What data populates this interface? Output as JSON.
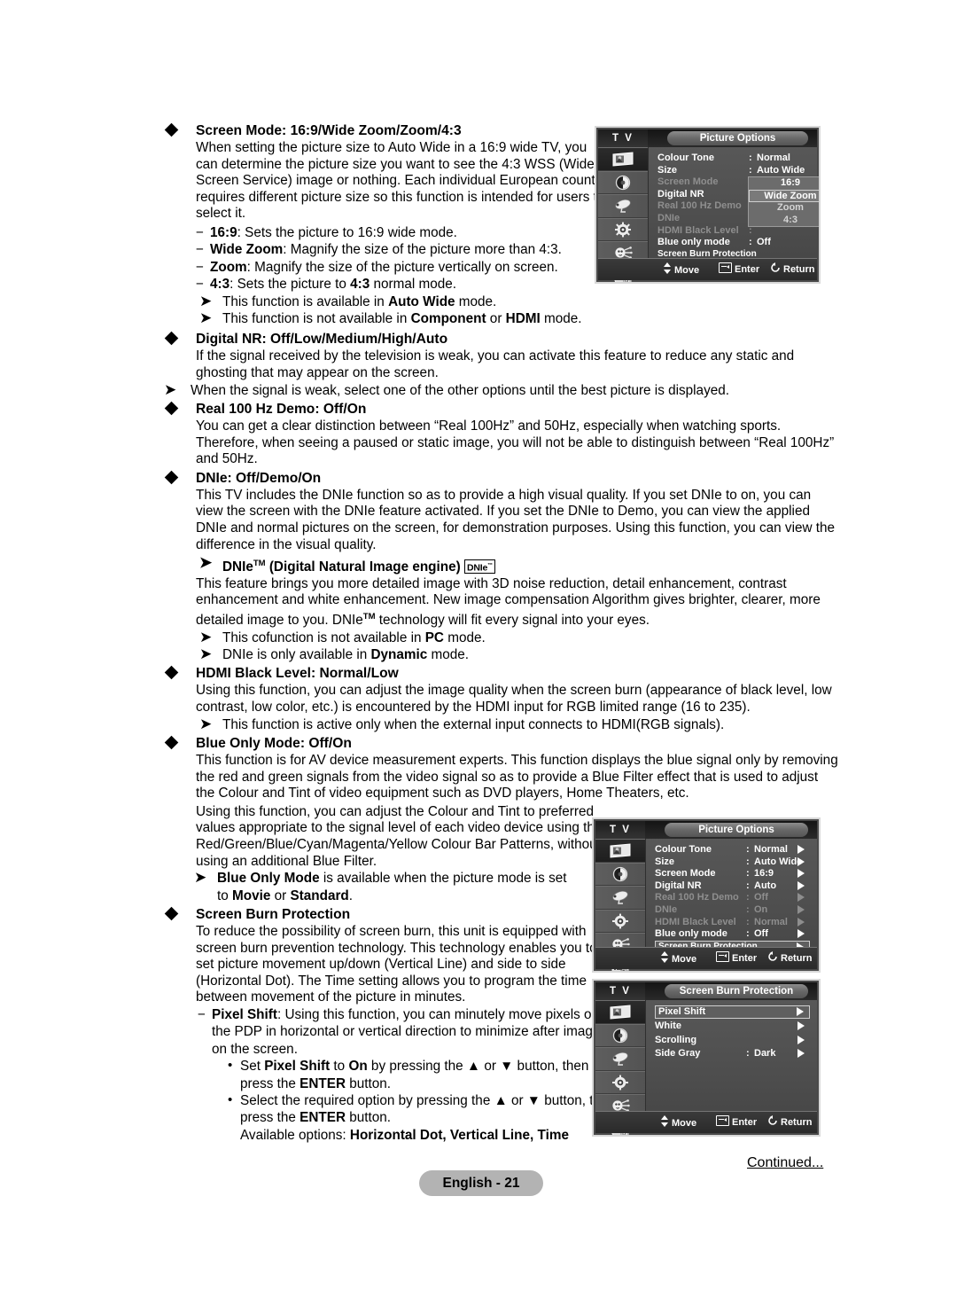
{
  "page": {
    "footer_badge": "English - 21",
    "continued": "Continued..."
  },
  "sections": [
    {
      "id": "screen-mode",
      "heading": "Screen Mode: 16:9/Wide Zoom/Zoom/4:3",
      "paragraph": "When setting the picture size to Auto Wide in a 16:9 wide TV, you can determine the picture size you want to see the 4:3 WSS (Wide Screen Service) image or nothing. Each individual European country requires different picture size so this function is intended for users to select it.",
      "dashes": [
        {
          "term": "16:9",
          "rest": ": Sets the picture to 16:9 wide mode."
        },
        {
          "term": "Wide Zoom",
          "rest": ": Magnify the size of the picture more than 4:3."
        },
        {
          "term": "Zoom",
          "rest": ": Magnify the size of the picture vertically on screen."
        },
        {
          "term": "4:3",
          "rest": ": Sets the picture to 4:3 normal mode."
        }
      ],
      "notes": [
        "This function is available in Auto Wide mode.",
        "This function is not available in Component or HDMI mode."
      ]
    },
    {
      "id": "digital-nr",
      "heading": "Digital NR: Off/Low/Medium/High/Auto",
      "paragraph": "If the signal received by the television is weak, you can activate this feature to reduce any static and ghosting that may appear on the screen.",
      "notes": [
        "When the signal is weak, select one of the other options until the best picture is displayed."
      ]
    },
    {
      "id": "real-100hz-demo",
      "heading": "Real 100 Hz Demo: Off/On",
      "paragraph": "You can get a clear distinction between “Real 100Hz” and 50Hz, especially when watching sports. Therefore, when seeing a paused or static image, you will not be able to distinguish between “Real 100Hz” and 50Hz."
    },
    {
      "id": "dnie",
      "heading": "DNIe: Off/Demo/On",
      "paragraph": "This TV includes the DNIe function so as to provide a high visual quality. If you set DNIe to on, you can view the screen with the DNIe feature activated. If you set the DNIe to Demo, you can view the applied DNIe and normal pictures on the screen, for demonstration purposes. Using this function, you can view the difference in the visual quality.",
      "sub_note_heading": "DNIe",
      "sub_note_heading_rest": "(Digital Natural Image engine)",
      "sub_note_badge": "DNIe",
      "sub_paragraph": "This feature brings you more detailed image with 3D noise reduction, detail enhancement, contrast enhancement and white enhancement. New image compensation Algorithm gives brighter, clearer, more detailed image to you. DNIe",
      "sub_paragraph_tail": " technology will fit every signal into your eyes.",
      "notes": [
        "This cofunction is not available in PC mode.",
        "DNIe is only available in Dynamic mode."
      ]
    },
    {
      "id": "hdmi-black-level",
      "heading": "HDMI Black Level: Normal/Low",
      "paragraph": "Using this function, you can adjust the image quality when the screen burn (appearance of black level, low contrast, low color, etc.) is encountered by the HDMI input for RGB limited range (16 to 235).",
      "notes": [
        "This function is active only when the external input connects to HDMI(RGB signals)."
      ]
    },
    {
      "id": "blue-only-mode",
      "heading": "Blue Only Mode: Off/On",
      "paragraph": "This function is for AV device measurement experts. This function displays the blue signal only by removing the red and green signals from the video signal so as to provide a Blue Filter effect that is used to adjust the Colour and Tint of video equipment such as DVD players, Home Theaters, etc.",
      "paragraph2": "Using this function, you can adjust the Colour and Tint to preferred values appropriate to the signal level of each video device using the Red/Green/Blue/Cyan/Magenta/Yellow Colour Bar Patterns, without using an additional Blue Filter.",
      "note_bold": "Blue Only Mode",
      "note_rest": " is available when the picture mode is set to ",
      "note_b2": "Movie",
      "note_mid": " or ",
      "note_b3": "Standard",
      "note_end": "."
    },
    {
      "id": "screen-burn-protection",
      "heading": "Screen Burn Protection",
      "paragraph": "To reduce the possibility of screen burn, this unit is equipped with screen burn prevention technology. This technology enables you to set picture movement up/down (Vertical Line) and side to side (Horizontal Dot). The Time setting allows you to program the time between movement of the picture in minutes.",
      "dash_term": "Pixel Shift",
      "dash_rest": ": Using this function, you can minutely move pixels on the PDP in horizontal or vertical direction to minimize after image on the screen.",
      "bullets": [
        {
          "pre": "Set ",
          "b1": "Pixel Shift",
          "mid": " to ",
          "b2": "On",
          "mid2": " by pressing the ▲ or ▼ button, then press the ",
          "b3": "ENTER",
          "tail": " button."
        },
        {
          "pre": "Select the required option by pressing the ▲ or ▼ button, then press the ",
          "b1": "ENTER",
          "tail": " button."
        }
      ],
      "available_label": "Available options: ",
      "available_options": "Horizontal Dot, Vertical Line, Time"
    }
  ],
  "osd1": {
    "tv_label": "T V",
    "title": "Picture Options",
    "rows": [
      {
        "label": "Colour Tone",
        "value": "Normal",
        "dim": false,
        "has_colon": true
      },
      {
        "label": "Size",
        "value": "Auto Wide",
        "dim": false,
        "has_colon": true
      },
      {
        "label": "Screen Mode",
        "value": "",
        "dim": true,
        "has_colon": true
      },
      {
        "label": "Digital NR",
        "value": "",
        "dim": false,
        "has_colon": true
      },
      {
        "label": "Real 100 Hz Demo",
        "value": "",
        "dim": true,
        "has_colon": true
      },
      {
        "label": "DNIe",
        "value": "",
        "dim": true,
        "has_colon": true
      },
      {
        "label": "HDMI Black Level",
        "value": "",
        "dim": true,
        "has_colon": true
      },
      {
        "label": "Blue only mode",
        "value": "Off",
        "dim": false,
        "has_colon": true
      },
      {
        "label": "Screen Burn Protection",
        "value": "",
        "dim": false,
        "has_colon": false
      }
    ],
    "dropdown": [
      {
        "label": "16:9",
        "state": "cur"
      },
      {
        "label": "Wide Zoom",
        "state": "hl"
      },
      {
        "label": "Zoom",
        "state": "normal"
      },
      {
        "label": "4:3",
        "state": "normal"
      }
    ],
    "footer": {
      "move": "Move",
      "enter": "Enter",
      "return": "Return"
    }
  },
  "osd2": {
    "tv_label": "T V",
    "title": "Picture Options",
    "rows": [
      {
        "label": "Colour Tone",
        "value": "Normal",
        "dim": false,
        "has_colon": true,
        "arrow": true,
        "selected": false
      },
      {
        "label": "Size",
        "value": "Auto Wide",
        "dim": false,
        "has_colon": true,
        "arrow": true,
        "selected": false
      },
      {
        "label": "Screen Mode",
        "value": "16:9",
        "dim": false,
        "has_colon": true,
        "arrow": true,
        "selected": false
      },
      {
        "label": "Digital NR",
        "value": "Auto",
        "dim": false,
        "has_colon": true,
        "arrow": true,
        "selected": false
      },
      {
        "label": "Real 100 Hz Demo",
        "value": "Off",
        "dim": true,
        "has_colon": true,
        "arrow": true,
        "selected": false
      },
      {
        "label": "DNIe",
        "value": "On",
        "dim": true,
        "has_colon": true,
        "arrow": true,
        "selected": false
      },
      {
        "label": "HDMI Black Level",
        "value": "Normal",
        "dim": true,
        "has_colon": true,
        "arrow": true,
        "selected": false
      },
      {
        "label": "Blue only mode",
        "value": "Off",
        "dim": false,
        "has_colon": true,
        "arrow": true,
        "selected": false
      },
      {
        "label": "Screen Burn Protection",
        "value": "",
        "dim": false,
        "has_colon": false,
        "arrow": true,
        "selected": true
      }
    ],
    "footer": {
      "move": "Move",
      "enter": "Enter",
      "return": "Return"
    }
  },
  "osd3": {
    "tv_label": "T V",
    "title": "Screen Burn Protection",
    "rows": [
      {
        "label": "Pixel Shift",
        "value": "",
        "dim": false,
        "has_colon": false,
        "arrow": true,
        "selected": true
      },
      {
        "label": "White",
        "value": "",
        "dim": false,
        "has_colon": false,
        "arrow": true,
        "selected": false
      },
      {
        "label": "Scrolling",
        "value": "",
        "dim": false,
        "has_colon": false,
        "arrow": true,
        "selected": false
      },
      {
        "label": "Side Gray",
        "value": "Dark",
        "dim": false,
        "has_colon": true,
        "arrow": true,
        "selected": false
      }
    ],
    "footer": {
      "move": "Move",
      "enter": "Enter",
      "return": "Return"
    }
  },
  "sidebar_icons": [
    "picture-icon",
    "sound-icon",
    "channel-dish-icon",
    "setup-gear-icon",
    "input-plug-icon",
    "digital-list-icon"
  ]
}
